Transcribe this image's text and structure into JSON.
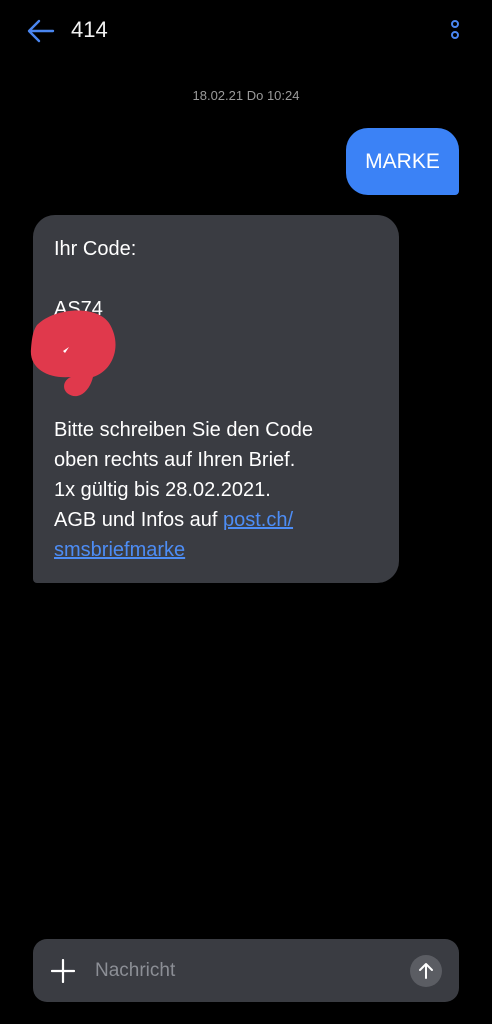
{
  "header": {
    "title": "414",
    "back_icon": "arrow-left-icon",
    "menu_icon": "more-vertical-icon",
    "accent_color": "#3b82f6"
  },
  "conversation": {
    "timestamp": "18.02.21 Do 10:24",
    "outgoing": {
      "text": "MARKE",
      "color": "#3b82f6"
    },
    "incoming": {
      "line1": "Ihr Code:",
      "code_partial": "AS74",
      "line3": "Bitte schreiben Sie den Code",
      "line4": "oben rechts auf Ihren Brief.",
      "line5": "1x gültig bis 28.02.2021.",
      "line6_prefix": "AGB und Infos auf ",
      "link_part1": "post.ch/",
      "link_part2": "smsbriefmarke",
      "color": "#3a3c42",
      "link_color": "#4d8df5"
    }
  },
  "composer": {
    "placeholder": "Nachricht",
    "add_icon": "plus-icon",
    "send_icon": "arrow-up-icon"
  }
}
